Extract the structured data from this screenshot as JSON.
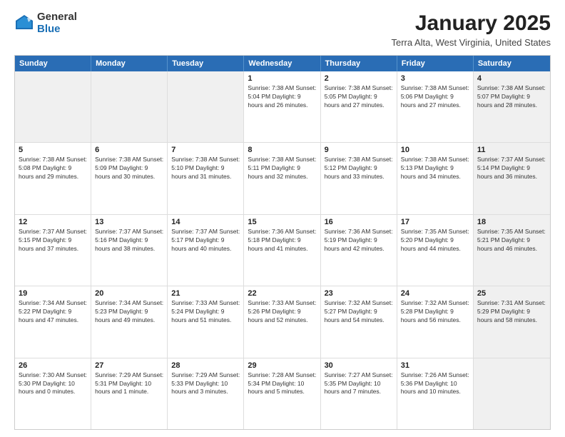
{
  "logo": {
    "general": "General",
    "blue": "Blue"
  },
  "title": "January 2025",
  "subtitle": "Terra Alta, West Virginia, United States",
  "header_days": [
    "Sunday",
    "Monday",
    "Tuesday",
    "Wednesday",
    "Thursday",
    "Friday",
    "Saturday"
  ],
  "weeks": [
    [
      {
        "day": "",
        "info": "",
        "shaded": true
      },
      {
        "day": "",
        "info": "",
        "shaded": true
      },
      {
        "day": "",
        "info": "",
        "shaded": true
      },
      {
        "day": "1",
        "info": "Sunrise: 7:38 AM\nSunset: 5:04 PM\nDaylight: 9 hours and 26 minutes.",
        "shaded": false
      },
      {
        "day": "2",
        "info": "Sunrise: 7:38 AM\nSunset: 5:05 PM\nDaylight: 9 hours and 27 minutes.",
        "shaded": false
      },
      {
        "day": "3",
        "info": "Sunrise: 7:38 AM\nSunset: 5:06 PM\nDaylight: 9 hours and 27 minutes.",
        "shaded": false
      },
      {
        "day": "4",
        "info": "Sunrise: 7:38 AM\nSunset: 5:07 PM\nDaylight: 9 hours and 28 minutes.",
        "shaded": true
      }
    ],
    [
      {
        "day": "5",
        "info": "Sunrise: 7:38 AM\nSunset: 5:08 PM\nDaylight: 9 hours and 29 minutes.",
        "shaded": false
      },
      {
        "day": "6",
        "info": "Sunrise: 7:38 AM\nSunset: 5:09 PM\nDaylight: 9 hours and 30 minutes.",
        "shaded": false
      },
      {
        "day": "7",
        "info": "Sunrise: 7:38 AM\nSunset: 5:10 PM\nDaylight: 9 hours and 31 minutes.",
        "shaded": false
      },
      {
        "day": "8",
        "info": "Sunrise: 7:38 AM\nSunset: 5:11 PM\nDaylight: 9 hours and 32 minutes.",
        "shaded": false
      },
      {
        "day": "9",
        "info": "Sunrise: 7:38 AM\nSunset: 5:12 PM\nDaylight: 9 hours and 33 minutes.",
        "shaded": false
      },
      {
        "day": "10",
        "info": "Sunrise: 7:38 AM\nSunset: 5:13 PM\nDaylight: 9 hours and 34 minutes.",
        "shaded": false
      },
      {
        "day": "11",
        "info": "Sunrise: 7:37 AM\nSunset: 5:14 PM\nDaylight: 9 hours and 36 minutes.",
        "shaded": true
      }
    ],
    [
      {
        "day": "12",
        "info": "Sunrise: 7:37 AM\nSunset: 5:15 PM\nDaylight: 9 hours and 37 minutes.",
        "shaded": false
      },
      {
        "day": "13",
        "info": "Sunrise: 7:37 AM\nSunset: 5:16 PM\nDaylight: 9 hours and 38 minutes.",
        "shaded": false
      },
      {
        "day": "14",
        "info": "Sunrise: 7:37 AM\nSunset: 5:17 PM\nDaylight: 9 hours and 40 minutes.",
        "shaded": false
      },
      {
        "day": "15",
        "info": "Sunrise: 7:36 AM\nSunset: 5:18 PM\nDaylight: 9 hours and 41 minutes.",
        "shaded": false
      },
      {
        "day": "16",
        "info": "Sunrise: 7:36 AM\nSunset: 5:19 PM\nDaylight: 9 hours and 42 minutes.",
        "shaded": false
      },
      {
        "day": "17",
        "info": "Sunrise: 7:35 AM\nSunset: 5:20 PM\nDaylight: 9 hours and 44 minutes.",
        "shaded": false
      },
      {
        "day": "18",
        "info": "Sunrise: 7:35 AM\nSunset: 5:21 PM\nDaylight: 9 hours and 46 minutes.",
        "shaded": true
      }
    ],
    [
      {
        "day": "19",
        "info": "Sunrise: 7:34 AM\nSunset: 5:22 PM\nDaylight: 9 hours and 47 minutes.",
        "shaded": false
      },
      {
        "day": "20",
        "info": "Sunrise: 7:34 AM\nSunset: 5:23 PM\nDaylight: 9 hours and 49 minutes.",
        "shaded": false
      },
      {
        "day": "21",
        "info": "Sunrise: 7:33 AM\nSunset: 5:24 PM\nDaylight: 9 hours and 51 minutes.",
        "shaded": false
      },
      {
        "day": "22",
        "info": "Sunrise: 7:33 AM\nSunset: 5:26 PM\nDaylight: 9 hours and 52 minutes.",
        "shaded": false
      },
      {
        "day": "23",
        "info": "Sunrise: 7:32 AM\nSunset: 5:27 PM\nDaylight: 9 hours and 54 minutes.",
        "shaded": false
      },
      {
        "day": "24",
        "info": "Sunrise: 7:32 AM\nSunset: 5:28 PM\nDaylight: 9 hours and 56 minutes.",
        "shaded": false
      },
      {
        "day": "25",
        "info": "Sunrise: 7:31 AM\nSunset: 5:29 PM\nDaylight: 9 hours and 58 minutes.",
        "shaded": true
      }
    ],
    [
      {
        "day": "26",
        "info": "Sunrise: 7:30 AM\nSunset: 5:30 PM\nDaylight: 10 hours and 0 minutes.",
        "shaded": false
      },
      {
        "day": "27",
        "info": "Sunrise: 7:29 AM\nSunset: 5:31 PM\nDaylight: 10 hours and 1 minute.",
        "shaded": false
      },
      {
        "day": "28",
        "info": "Sunrise: 7:29 AM\nSunset: 5:33 PM\nDaylight: 10 hours and 3 minutes.",
        "shaded": false
      },
      {
        "day": "29",
        "info": "Sunrise: 7:28 AM\nSunset: 5:34 PM\nDaylight: 10 hours and 5 minutes.",
        "shaded": false
      },
      {
        "day": "30",
        "info": "Sunrise: 7:27 AM\nSunset: 5:35 PM\nDaylight: 10 hours and 7 minutes.",
        "shaded": false
      },
      {
        "day": "31",
        "info": "Sunrise: 7:26 AM\nSunset: 5:36 PM\nDaylight: 10 hours and 10 minutes.",
        "shaded": false
      },
      {
        "day": "",
        "info": "",
        "shaded": true
      }
    ]
  ]
}
